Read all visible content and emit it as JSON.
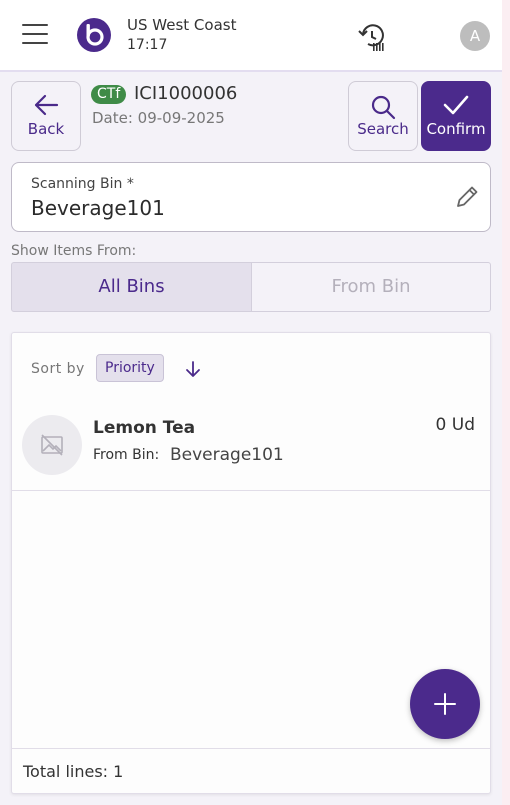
{
  "header": {
    "org_name": "US West Coast",
    "time": "17:17",
    "avatar_initial": "A"
  },
  "toolbar": {
    "back_label": "Back",
    "search_label": "Search",
    "confirm_label": "Confirm"
  },
  "document": {
    "badge": "CTf",
    "id": "ICI1000006",
    "date": "Date: 09-09-2025"
  },
  "scanning_bin": {
    "label": "Scanning Bin *",
    "value": "Beverage101"
  },
  "show_items": {
    "label": "Show Items From:",
    "options": [
      "All Bins",
      "From Bin"
    ],
    "selected": "All Bins"
  },
  "sort": {
    "label": "Sort by",
    "value": "Priority"
  },
  "items": [
    {
      "name": "Lemon Tea",
      "from_bin_label": "From Bin:",
      "from_bin": "Beverage101",
      "quantity": "0 Ud"
    }
  ],
  "footer": {
    "total_lines": "Total lines: 1"
  },
  "colors": {
    "primary": "#4b2a8c",
    "badge_green": "#3f8b47",
    "background": "#f4f2f8"
  }
}
